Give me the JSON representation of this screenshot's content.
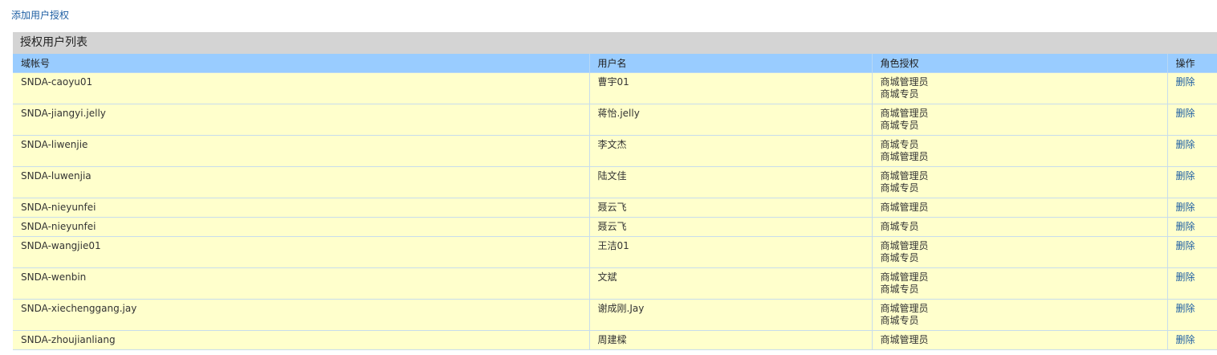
{
  "add_link": "添加用户授权",
  "panel_title": "授权用户列表",
  "columns": {
    "account": "域帐号",
    "username": "用户名",
    "roles": "角色授权",
    "action": "操作"
  },
  "delete_label": "删除",
  "rows": [
    {
      "account": "SNDA-caoyu01",
      "username": "曹宇01",
      "roles": [
        "商城管理员",
        "商城专员"
      ]
    },
    {
      "account": "SNDA-jiangyi.jelly",
      "username": "蒋怡.jelly",
      "roles": [
        "商城管理员",
        "商城专员"
      ]
    },
    {
      "account": "SNDA-liwenjie",
      "username": "李文杰",
      "roles": [
        "商城专员",
        "商城管理员"
      ]
    },
    {
      "account": "SNDA-luwenjia",
      "username": "陆文佳",
      "roles": [
        "商城管理员",
        "商城专员"
      ]
    },
    {
      "account": "SNDA-nieyunfei",
      "username": "聂云飞",
      "roles": [
        "商城管理员"
      ]
    },
    {
      "account": "SNDA-nieyunfei",
      "username": "聂云飞",
      "roles": [
        "商城专员"
      ]
    },
    {
      "account": "SNDA-wangjie01",
      "username": "王洁01",
      "roles": [
        "商城管理员",
        "商城专员"
      ]
    },
    {
      "account": "SNDA-wenbin",
      "username": "文斌",
      "roles": [
        "商城管理员",
        "商城专员"
      ]
    },
    {
      "account": "SNDA-xiechenggang.jay",
      "username": "谢成刚.Jay",
      "roles": [
        "商城管理员",
        "商城专员"
      ]
    },
    {
      "account": "SNDA-zhoujianliang",
      "username": "周建樑",
      "roles": [
        "商城管理员"
      ]
    }
  ]
}
